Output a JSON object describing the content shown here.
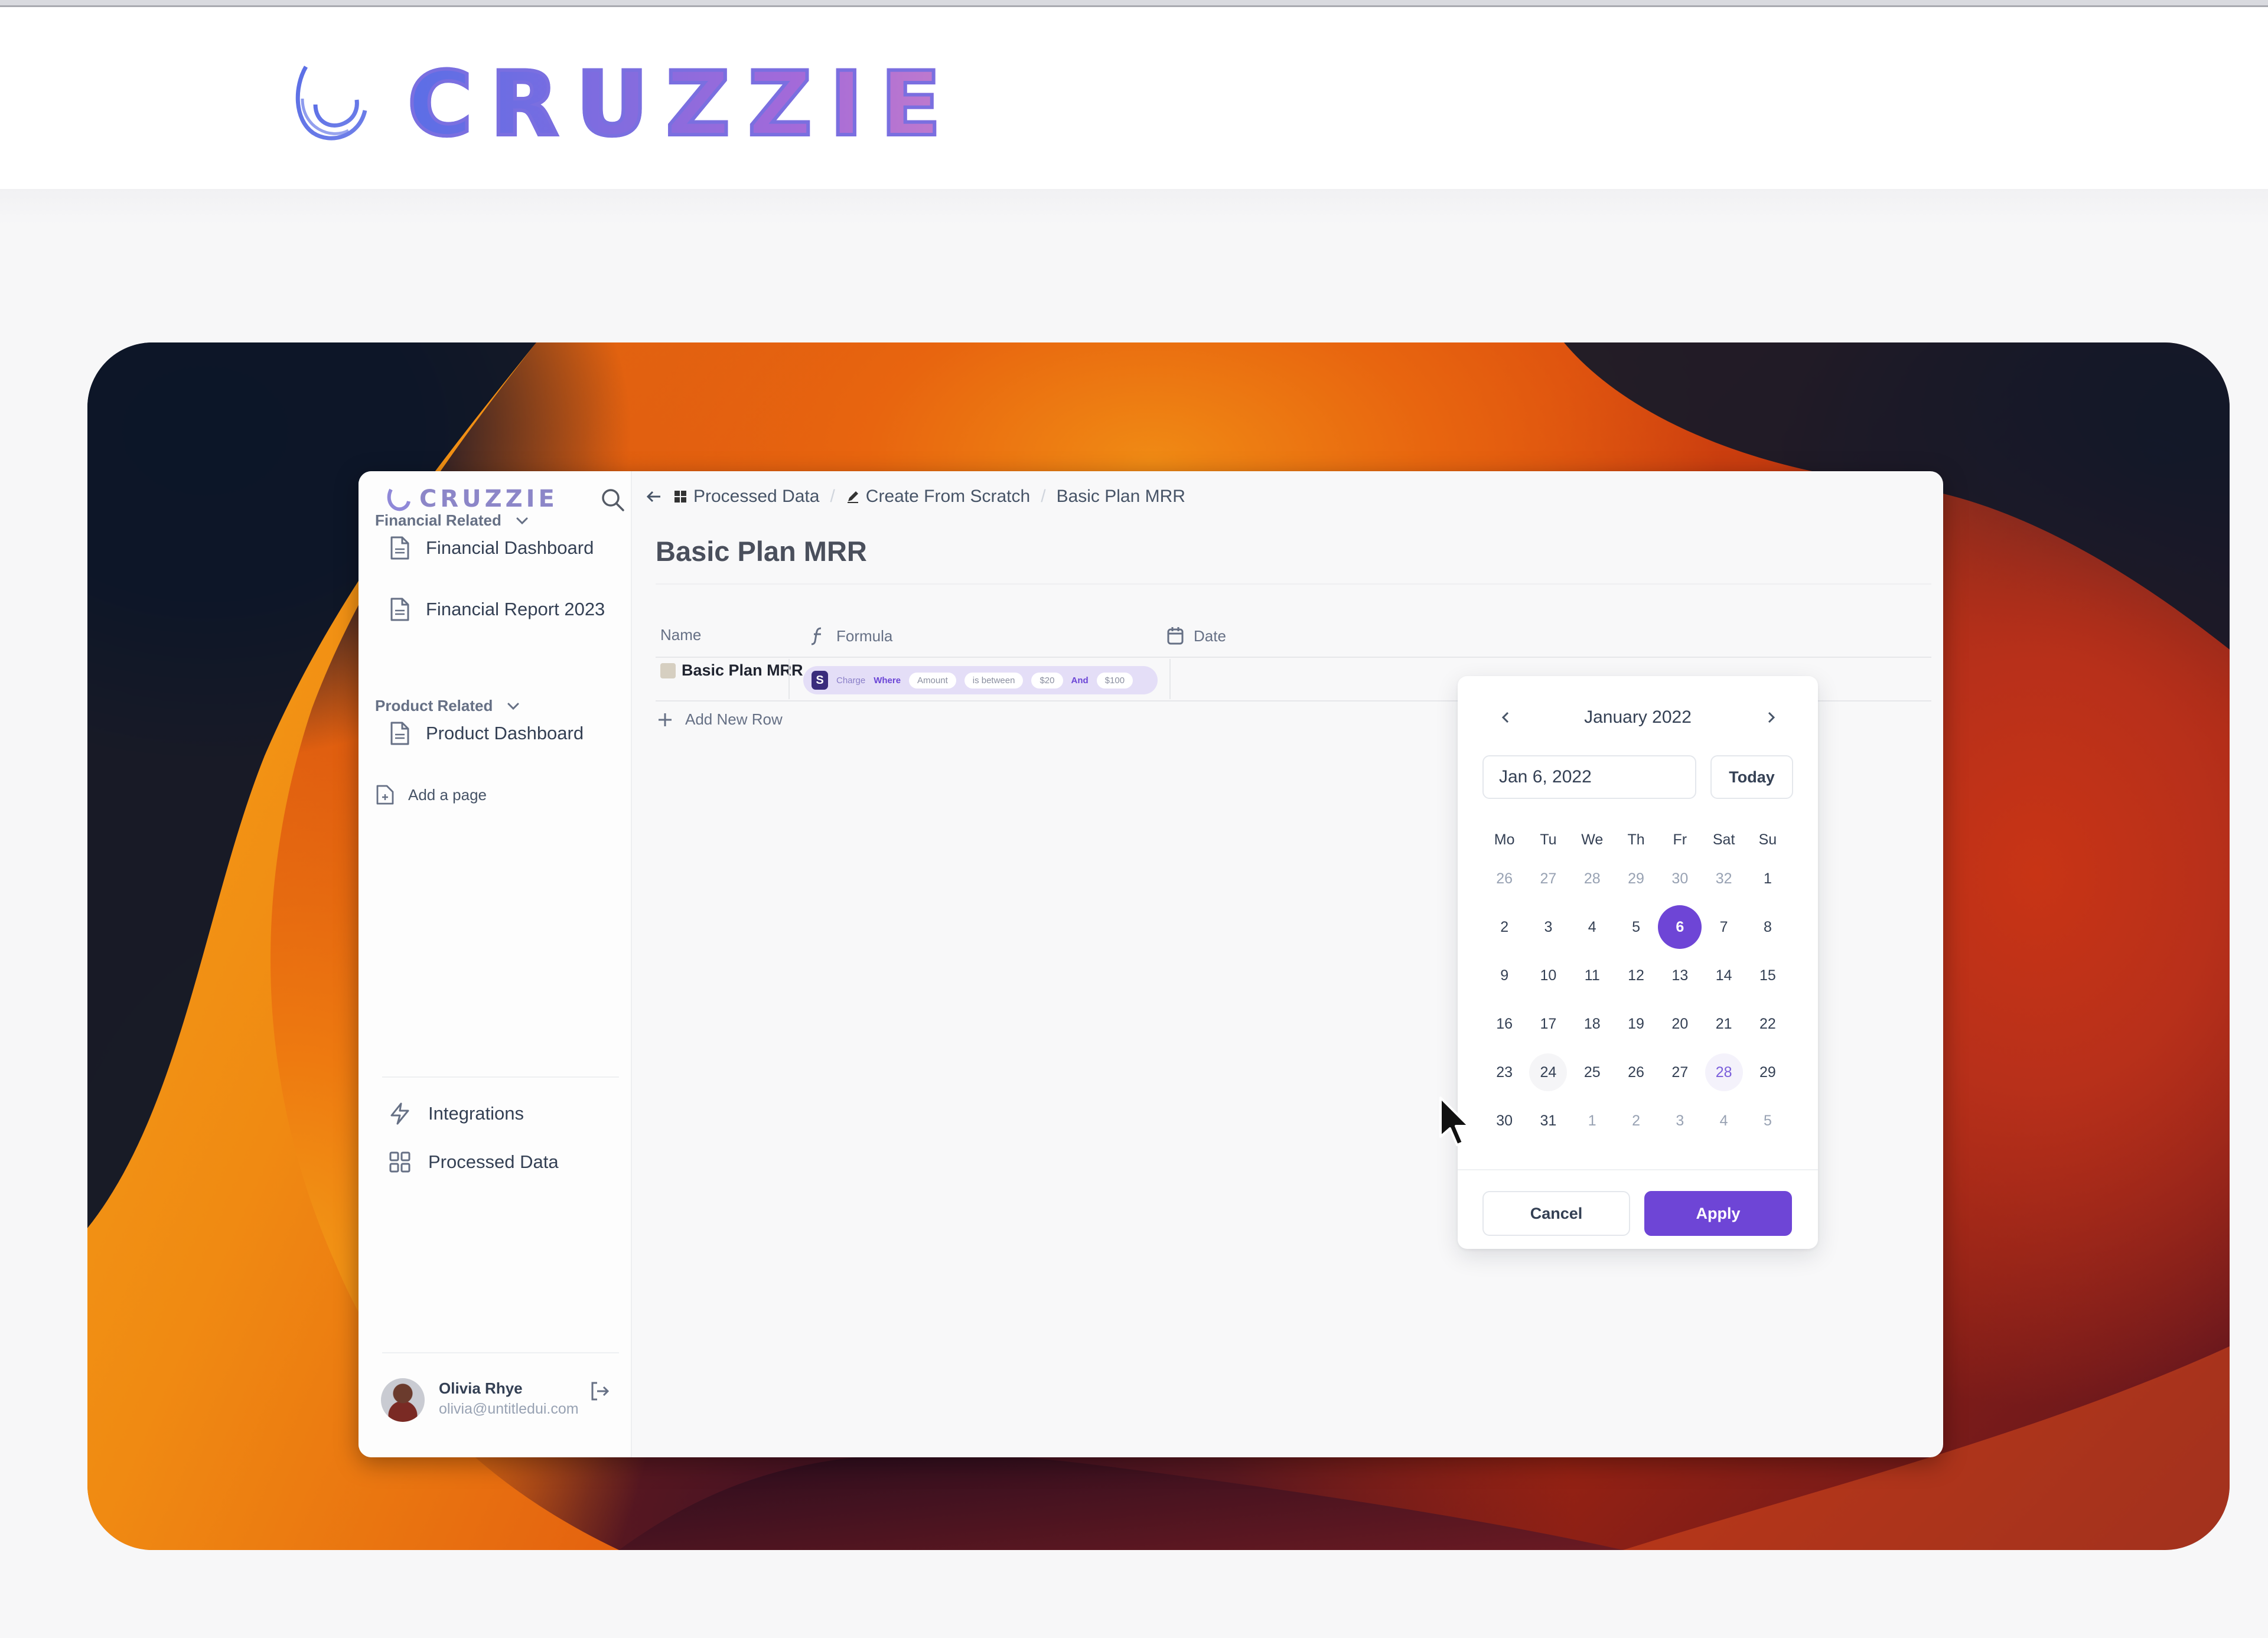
{
  "site": {
    "brand_name": "CRUZZIE"
  },
  "app": {
    "sidebar": {
      "logo_text": "CRUZZIE",
      "sections": [
        {
          "label": "Financial Related",
          "items": [
            {
              "label": "Financial Dashboard",
              "icon": "file-icon"
            },
            {
              "label": "Financial Report 2023",
              "icon": "file-icon"
            }
          ]
        },
        {
          "label": "Product Related",
          "items": [
            {
              "label": "Product Dashboard",
              "icon": "file-icon"
            }
          ]
        }
      ],
      "add_page": "Add a page",
      "footer_items": [
        {
          "label": "Integrations",
          "icon": "zap-icon"
        },
        {
          "label": "Processed Data",
          "icon": "grid-icon"
        }
      ],
      "user": {
        "name": "Olivia Rhye",
        "email": "olivia@untitledui.com"
      }
    },
    "breadcrumb": [
      {
        "label": "Processed Data",
        "icon": "grid-icon"
      },
      {
        "label": "Create From Scratch",
        "icon": "pen-icon"
      },
      {
        "label": "Basic Plan MRR"
      }
    ],
    "search_label": "Search",
    "page_title": "Basic Plan MRR",
    "table": {
      "columns": [
        {
          "label": "Name"
        },
        {
          "label": "Formula",
          "icon": "function-icon"
        },
        {
          "label": "Date",
          "icon": "calendar-icon"
        }
      ],
      "rows": [
        {
          "name": "Basic Plan MRR",
          "formula": {
            "source": "Charge",
            "where": "Where",
            "field": "Amount",
            "operator": "is between",
            "value_1": "$20",
            "joiner": "And",
            "value_2": "$100"
          }
        }
      ],
      "add_row": "Add New Row"
    },
    "date_picker": {
      "month_label": "January 2022",
      "input_value": "Jan 6, 2022",
      "today_label": "Today",
      "weekdays": [
        "Mo",
        "Tu",
        "We",
        "Th",
        "Fr",
        "Sat",
        "Su"
      ],
      "weeks": [
        [
          {
            "d": "26",
            "m": true
          },
          {
            "d": "27",
            "m": true
          },
          {
            "d": "28",
            "m": true
          },
          {
            "d": "29",
            "m": true
          },
          {
            "d": "30",
            "m": true
          },
          {
            "d": "32",
            "m": true
          },
          {
            "d": "1"
          }
        ],
        [
          {
            "d": "2"
          },
          {
            "d": "3"
          },
          {
            "d": "4"
          },
          {
            "d": "5"
          },
          {
            "d": "6",
            "selected": true
          },
          {
            "d": "7"
          },
          {
            "d": "8"
          }
        ],
        [
          {
            "d": "9"
          },
          {
            "d": "10"
          },
          {
            "d": "11"
          },
          {
            "d": "12"
          },
          {
            "d": "13"
          },
          {
            "d": "14"
          },
          {
            "d": "15"
          }
        ],
        [
          {
            "d": "16"
          },
          {
            "d": "17"
          },
          {
            "d": "18"
          },
          {
            "d": "19"
          },
          {
            "d": "20"
          },
          {
            "d": "21"
          },
          {
            "d": "22"
          }
        ],
        [
          {
            "d": "23"
          },
          {
            "d": "24",
            "today": true
          },
          {
            "d": "25"
          },
          {
            "d": "26"
          },
          {
            "d": "27"
          },
          {
            "d": "28",
            "hover": true
          },
          {
            "d": "29"
          }
        ],
        [
          {
            "d": "30"
          },
          {
            "d": "31"
          },
          {
            "d": "1",
            "m": true
          },
          {
            "d": "2",
            "m": true
          },
          {
            "d": "3",
            "m": true
          },
          {
            "d": "4",
            "m": true
          },
          {
            "d": "5",
            "m": true
          }
        ]
      ],
      "cancel_label": "Cancel",
      "apply_label": "Apply"
    }
  },
  "colors": {
    "accent": "#6e45d6",
    "brand_gradient_start": "#5b6ee6",
    "brand_gradient_end": "#c27bcc"
  }
}
